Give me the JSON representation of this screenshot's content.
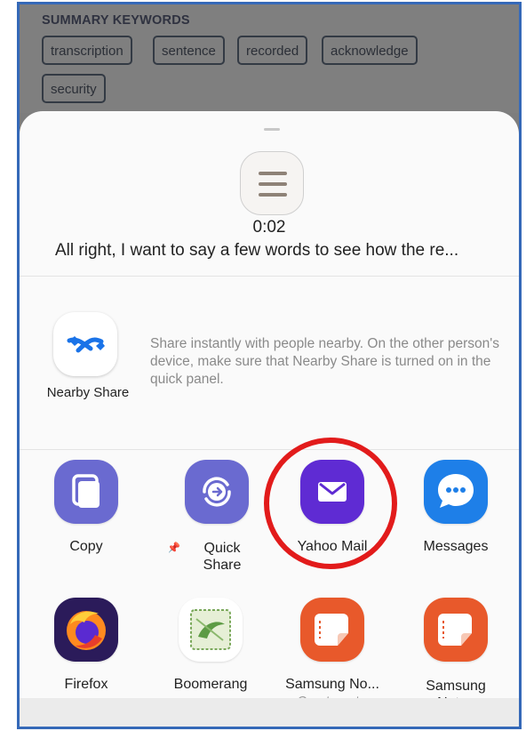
{
  "summary": {
    "title": "SUMMARY KEYWORDS",
    "keywords": [
      "transcription",
      "sentence",
      "recorded",
      "acknowledge",
      "security"
    ]
  },
  "preview": {
    "duration": "0:02",
    "snippet": "All right, I want to say a few words to see how the re..."
  },
  "nearby": {
    "label": "Nearby Share",
    "description": "Share instantly with people nearby. On the other person's device, make sure that Nearby Share is turned on in the quick panel."
  },
  "apps_row1": [
    {
      "label": "Copy",
      "icon": "copy-icon"
    },
    {
      "label": "Quick Share",
      "label_line1": "Quick",
      "label_line2": "Share",
      "icon": "quick-share-icon"
    },
    {
      "label": "Yahoo Mail",
      "icon": "yahoo-mail-icon"
    },
    {
      "label": "Messages",
      "icon": "messages-icon"
    }
  ],
  "apps_row2": [
    {
      "label": "Firefox",
      "icon": "firefox-icon"
    },
    {
      "label": "Boomerang",
      "icon": "boomerang-icon"
    },
    {
      "label": "Samsung No...",
      "sublabel": "Create note",
      "icon": "samsung-notes-icon"
    },
    {
      "label": "Samsung Notes",
      "label_line1": "Samsung",
      "label_line2": "Notes",
      "icon": "samsung-notes-icon"
    }
  ],
  "colors": {
    "highlight_circle": "#e21b1b",
    "frame_border": "#3569b8",
    "yahoo_purple": "#5f2bd3",
    "samsung_notes_orange": "#e8592b"
  }
}
